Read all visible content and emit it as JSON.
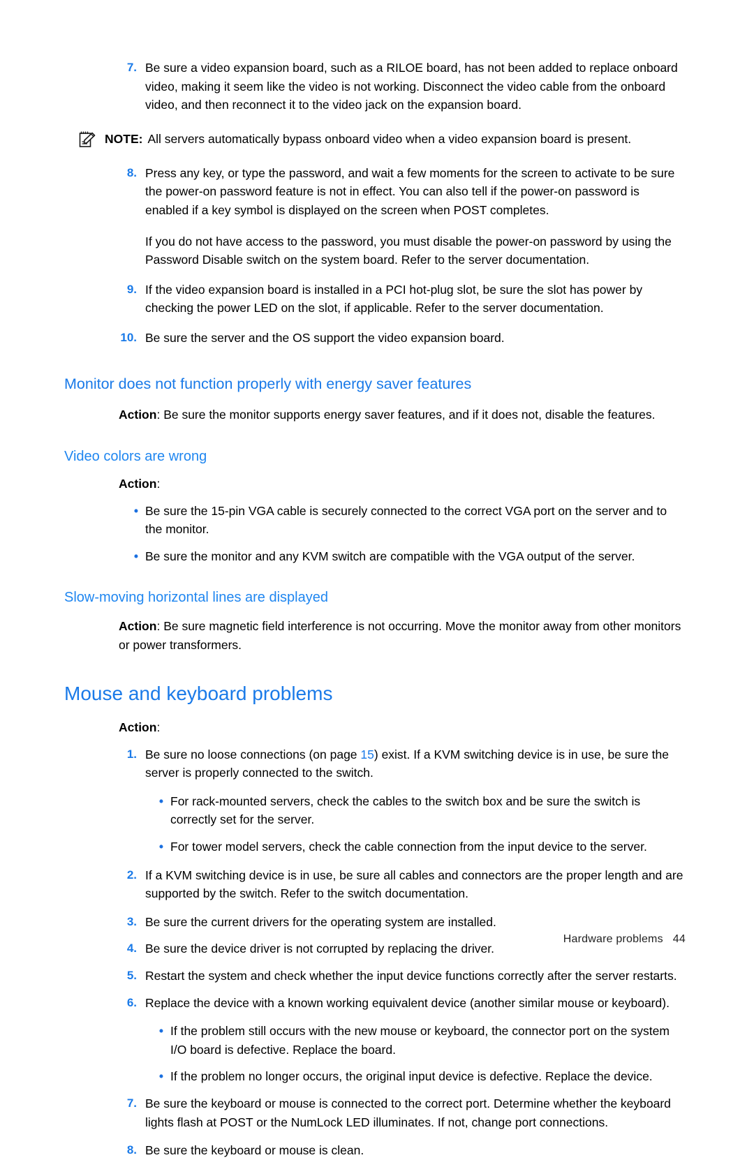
{
  "document": {
    "footer": {
      "section": "Hardware problems",
      "page_number": "44"
    },
    "colors": {
      "heading_blue": "#1a7ae8",
      "bullet_blue": "#1a6fe0",
      "link_blue": "#1a7ae8",
      "body_text": "#000000"
    }
  },
  "video_list": {
    "item7": {
      "number": "7.",
      "text": "Be sure a video expansion board, such as a RILOE board, has not been added to replace onboard video, making it seem like the video is not working. Disconnect the video cable from the onboard video, and then reconnect it to the video jack on the expansion board."
    },
    "note": {
      "icon": "note-pencil-icon",
      "label": "NOTE:",
      "text": "All servers automatically bypass onboard video when a video expansion board is present."
    },
    "item8": {
      "number": "8.",
      "text": "Press any key, or type the password, and wait a few moments for the screen to activate to be sure the power-on password feature is not in effect. You can also tell if the power-on password is enabled if a key symbol is displayed on the screen when POST completes.",
      "continuation": "If you do not have access to the password, you must disable the power-on password by using the Password Disable switch on the system board. Refer to the server documentation."
    },
    "item9": {
      "number": "9.",
      "text": "If the video expansion board is installed in a PCI hot-plug slot, be sure the slot has power by checking the power LED on the slot, if applicable. Refer to the server documentation."
    },
    "item10": {
      "number": "10.",
      "text": "Be sure the server and the OS support the video expansion board."
    }
  },
  "section_energy_saver": {
    "heading": "Monitor does not function properly with energy saver features",
    "action_label": "Action",
    "action_colon": ": ",
    "action_text": "Be sure the monitor supports energy saver features, and if it does not, disable the features."
  },
  "section_video_colors": {
    "heading": "Video colors are wrong",
    "action_label": "Action",
    "action_colon": ":",
    "bullets": [
      "Be sure the 15-pin VGA cable is securely connected to the correct VGA port on the server and to the monitor.",
      "Be sure the monitor and any KVM switch are compatible with the VGA output of the server."
    ]
  },
  "section_horizontal_lines": {
    "heading": "Slow-moving horizontal lines are displayed",
    "action_label": "Action",
    "action_colon": ": ",
    "action_text": "Be sure magnetic field interference is not occurring. Move the monitor away from other monitors or power transformers."
  },
  "section_mouse_keyboard": {
    "heading": "Mouse and keyboard problems",
    "action_label": "Action",
    "action_colon": ":",
    "item1": {
      "number": "1.",
      "text_before_link": "Be sure no loose connections (on page ",
      "link_text": "15",
      "text_after_link": ") exist. If a KVM switching device is in use, be sure the server is properly connected to the switch.",
      "sub_bullets": [
        "For rack-mounted servers, check the cables to the switch box and be sure the switch is correctly set for the server.",
        "For tower model servers, check the cable connection from the input device to the server."
      ]
    },
    "item2": {
      "number": "2.",
      "text": "If a KVM switching device is in use, be sure all cables and connectors are the proper length and are supported by the switch. Refer to the switch documentation."
    },
    "item3": {
      "number": "3.",
      "text": "Be sure the current drivers for the operating system are installed."
    },
    "item4": {
      "number": "4.",
      "text": "Be sure the device driver is not corrupted by replacing the driver."
    },
    "item5": {
      "number": "5.",
      "text": "Restart the system and check whether the input device functions correctly after the server restarts."
    },
    "item6": {
      "number": "6.",
      "text": "Replace the device with a known working equivalent device (another similar mouse or keyboard).",
      "sub_bullets": [
        "If the problem still occurs with the new mouse or keyboard, the connector port on the system I/O board is defective. Replace the board.",
        "If the problem no longer occurs, the original input device is defective. Replace the device."
      ]
    },
    "item7": {
      "number": "7.",
      "text": "Be sure the keyboard or mouse is connected to the correct port. Determine whether the keyboard lights flash at POST or the NumLock LED illuminates. If not, change port connections."
    },
    "item8": {
      "number": "8.",
      "text": "Be sure the keyboard or mouse is clean."
    }
  }
}
